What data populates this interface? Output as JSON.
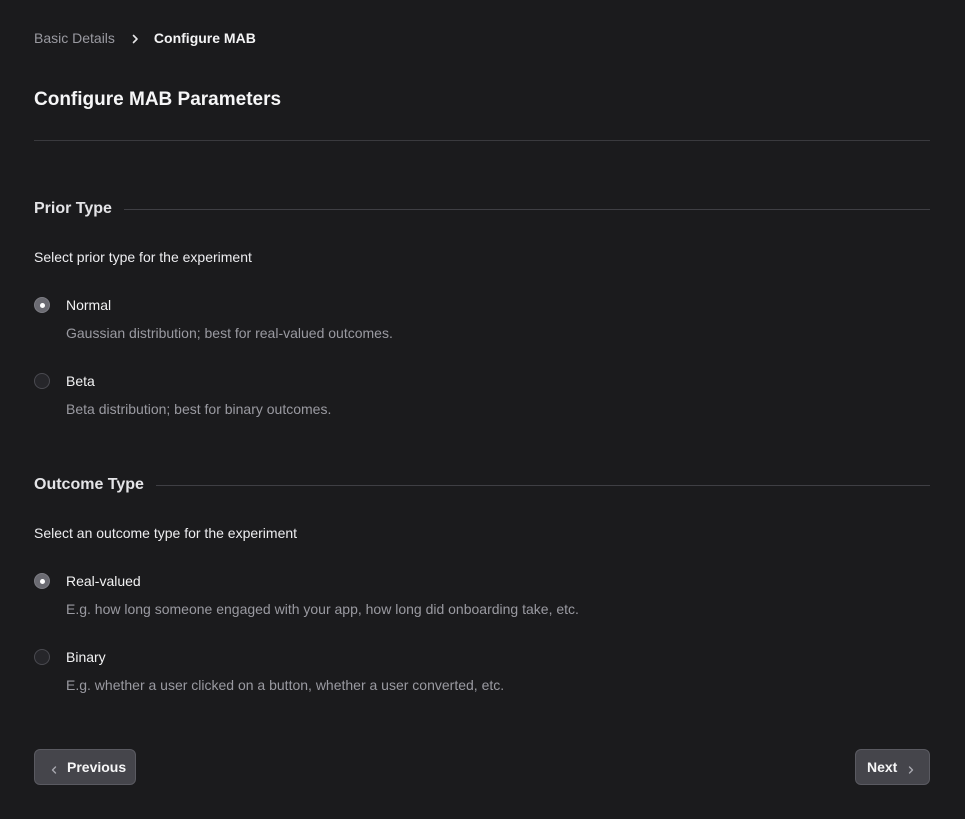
{
  "breadcrumb": {
    "previous": "Basic Details",
    "current": "Configure MAB"
  },
  "page": {
    "title": "Configure MAB Parameters"
  },
  "prior_section": {
    "legend": "Prior Type",
    "description": "Select prior type for the experiment",
    "options": [
      {
        "label": "Normal",
        "help": "Gaussian distribution; best for real-valued outcomes.",
        "selected": true
      },
      {
        "label": "Beta",
        "help": "Beta distribution; best for binary outcomes.",
        "selected": false
      }
    ]
  },
  "outcome_section": {
    "legend": "Outcome Type",
    "description": "Select an outcome type for the experiment",
    "options": [
      {
        "label": "Real-valued",
        "help": "E.g. how long someone engaged with your app, how long did onboarding take, etc.",
        "selected": true
      },
      {
        "label": "Binary",
        "help": "E.g. whether a user clicked on a button, whether a user converted, etc.",
        "selected": false
      }
    ]
  },
  "footer": {
    "previous_label": "Previous",
    "next_label": "Next"
  },
  "icons": {
    "breadcrumb_separator": "chevron-right-icon",
    "previous": "chevron-left-icon",
    "next": "chevron-right-icon"
  },
  "colors": {
    "background": "#1b1b1d",
    "radio_checked": "#6b6b72",
    "button_bg": "#45454b",
    "muted_text": "#9a9aa1"
  }
}
